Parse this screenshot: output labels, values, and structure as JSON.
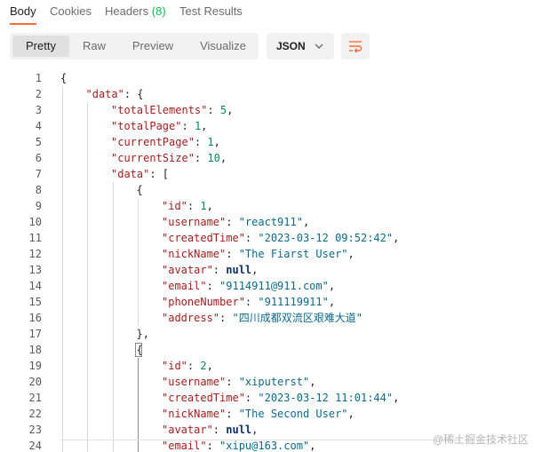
{
  "tabs": [
    {
      "label": "Body",
      "active": true
    },
    {
      "label": "Cookies",
      "active": false
    },
    {
      "label": "Headers",
      "count": "(8)",
      "active": false
    },
    {
      "label": "Test Results",
      "active": false
    }
  ],
  "view_modes": [
    {
      "label": "Pretty",
      "active": true
    },
    {
      "label": "Raw",
      "active": false
    },
    {
      "label": "Preview",
      "active": false
    },
    {
      "label": "Visualize",
      "active": false
    }
  ],
  "language": {
    "selected": "JSON",
    "icon": "chevron-down-icon"
  },
  "wrap_icon": "wrap-lines-icon",
  "code_lines": [
    {
      "n": "1",
      "indent": 0,
      "tokens": [
        {
          "t": "{",
          "c": "p"
        }
      ]
    },
    {
      "n": "2",
      "indent": 1,
      "tokens": [
        {
          "t": "\"data\"",
          "c": "k"
        },
        {
          "t": ": {",
          "c": "p"
        }
      ]
    },
    {
      "n": "3",
      "indent": 2,
      "tokens": [
        {
          "t": "\"totalElements\"",
          "c": "k"
        },
        {
          "t": ": ",
          "c": "p"
        },
        {
          "t": "5",
          "c": "n"
        },
        {
          "t": ",",
          "c": "p"
        }
      ]
    },
    {
      "n": "4",
      "indent": 2,
      "tokens": [
        {
          "t": "\"totalPage\"",
          "c": "k"
        },
        {
          "t": ": ",
          "c": "p"
        },
        {
          "t": "1",
          "c": "n"
        },
        {
          "t": ",",
          "c": "p"
        }
      ]
    },
    {
      "n": "5",
      "indent": 2,
      "tokens": [
        {
          "t": "\"currentPage\"",
          "c": "k"
        },
        {
          "t": ": ",
          "c": "p"
        },
        {
          "t": "1",
          "c": "n"
        },
        {
          "t": ",",
          "c": "p"
        }
      ]
    },
    {
      "n": "6",
      "indent": 2,
      "tokens": [
        {
          "t": "\"currentSize\"",
          "c": "k"
        },
        {
          "t": ": ",
          "c": "p"
        },
        {
          "t": "10",
          "c": "n"
        },
        {
          "t": ",",
          "c": "p"
        }
      ]
    },
    {
      "n": "7",
      "indent": 2,
      "tokens": [
        {
          "t": "\"data\"",
          "c": "k"
        },
        {
          "t": ": [",
          "c": "p"
        }
      ]
    },
    {
      "n": "8",
      "indent": 3,
      "tokens": [
        {
          "t": "{",
          "c": "p"
        }
      ]
    },
    {
      "n": "9",
      "indent": 4,
      "tokens": [
        {
          "t": "\"id\"",
          "c": "k"
        },
        {
          "t": ": ",
          "c": "p"
        },
        {
          "t": "1",
          "c": "n"
        },
        {
          "t": ",",
          "c": "p"
        }
      ]
    },
    {
      "n": "10",
      "indent": 4,
      "tokens": [
        {
          "t": "\"username\"",
          "c": "k"
        },
        {
          "t": ": ",
          "c": "p"
        },
        {
          "t": "\"react911\"",
          "c": "s"
        },
        {
          "t": ",",
          "c": "p"
        }
      ]
    },
    {
      "n": "11",
      "indent": 4,
      "tokens": [
        {
          "t": "\"createdTime\"",
          "c": "k"
        },
        {
          "t": ": ",
          "c": "p"
        },
        {
          "t": "\"2023-03-12 09:52:42\"",
          "c": "s"
        },
        {
          "t": ",",
          "c": "p"
        }
      ]
    },
    {
      "n": "12",
      "indent": 4,
      "tokens": [
        {
          "t": "\"nickName\"",
          "c": "k"
        },
        {
          "t": ": ",
          "c": "p"
        },
        {
          "t": "\"The Fiarst User\"",
          "c": "s"
        },
        {
          "t": ",",
          "c": "p"
        }
      ]
    },
    {
      "n": "13",
      "indent": 4,
      "tokens": [
        {
          "t": "\"avatar\"",
          "c": "k"
        },
        {
          "t": ": ",
          "c": "p"
        },
        {
          "t": "null",
          "c": "b"
        },
        {
          "t": ",",
          "c": "p"
        }
      ]
    },
    {
      "n": "14",
      "indent": 4,
      "tokens": [
        {
          "t": "\"email\"",
          "c": "k"
        },
        {
          "t": ": ",
          "c": "p"
        },
        {
          "t": "\"9114911@911.com\"",
          "c": "s"
        },
        {
          "t": ",",
          "c": "p"
        }
      ]
    },
    {
      "n": "15",
      "indent": 4,
      "tokens": [
        {
          "t": "\"phoneNumber\"",
          "c": "k"
        },
        {
          "t": ": ",
          "c": "p"
        },
        {
          "t": "\"911119911\"",
          "c": "s"
        },
        {
          "t": ",",
          "c": "p"
        }
      ]
    },
    {
      "n": "16",
      "indent": 4,
      "tokens": [
        {
          "t": "\"address\"",
          "c": "k"
        },
        {
          "t": ": ",
          "c": "p"
        },
        {
          "t": "\"四川成都双流区艰难大道\"",
          "c": "s"
        }
      ]
    },
    {
      "n": "17",
      "indent": 3,
      "tokens": [
        {
          "t": "},",
          "c": "p"
        }
      ]
    },
    {
      "n": "18",
      "indent": 3,
      "tokens": [
        {
          "t": "{",
          "c": "p"
        }
      ]
    },
    {
      "n": "19",
      "indent": 4,
      "tokens": [
        {
          "t": "\"id\"",
          "c": "k"
        },
        {
          "t": ": ",
          "c": "p"
        },
        {
          "t": "2",
          "c": "n"
        },
        {
          "t": ",",
          "c": "p"
        }
      ]
    },
    {
      "n": "20",
      "indent": 4,
      "tokens": [
        {
          "t": "\"username\"",
          "c": "k"
        },
        {
          "t": ": ",
          "c": "p"
        },
        {
          "t": "\"xiputerst\"",
          "c": "s"
        },
        {
          "t": ",",
          "c": "p"
        }
      ]
    },
    {
      "n": "21",
      "indent": 4,
      "tokens": [
        {
          "t": "\"createdTime\"",
          "c": "k"
        },
        {
          "t": ": ",
          "c": "p"
        },
        {
          "t": "\"2023-03-12 11:01:44\"",
          "c": "s"
        },
        {
          "t": ",",
          "c": "p"
        }
      ]
    },
    {
      "n": "22",
      "indent": 4,
      "tokens": [
        {
          "t": "\"nickName\"",
          "c": "k"
        },
        {
          "t": ": ",
          "c": "p"
        },
        {
          "t": "\"The Second User\"",
          "c": "s"
        },
        {
          "t": ",",
          "c": "p"
        }
      ]
    },
    {
      "n": "23",
      "indent": 4,
      "tokens": [
        {
          "t": "\"avatar\"",
          "c": "k"
        },
        {
          "t": ": ",
          "c": "p"
        },
        {
          "t": "null",
          "c": "b"
        },
        {
          "t": ",",
          "c": "p"
        }
      ]
    },
    {
      "n": "24",
      "indent": 4,
      "tokens": [
        {
          "t": "\"email\"",
          "c": "k"
        },
        {
          "t": ": ",
          "c": "p"
        },
        {
          "t": "\"xipu@163.com\"",
          "c": "s"
        },
        {
          "t": ",",
          "c": "p"
        }
      ]
    }
  ],
  "watermark": "@稀土掘金技术社区",
  "colors": {
    "accent": "#ff6c37",
    "count": "#0cbb52",
    "key": "#a61d1d",
    "string": "#0b6a8e",
    "number": "#09885a",
    "literal": "#0d2d70"
  }
}
